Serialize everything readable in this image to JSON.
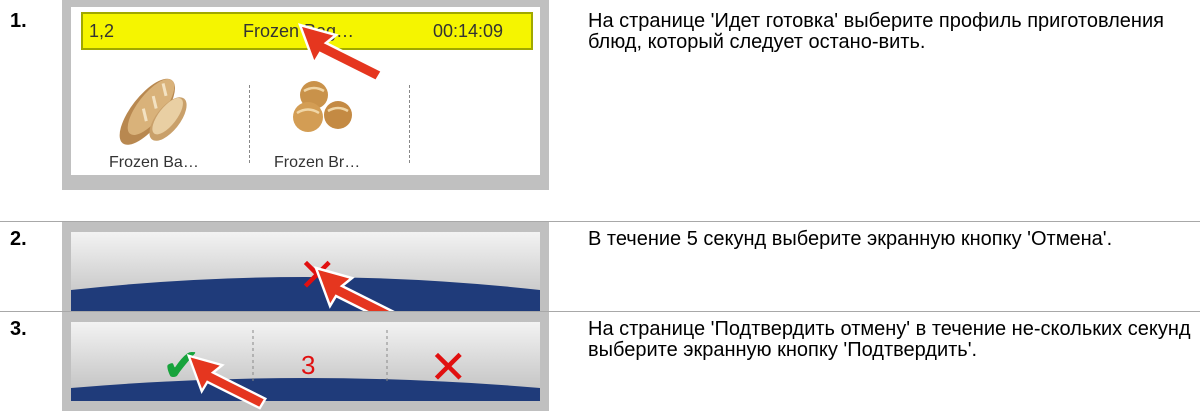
{
  "steps": [
    {
      "number": "1.",
      "text": "На странице 'Идет готовка' выберите профиль приготовления блюд, который следует остано-вить.",
      "screen": {
        "bar_col1": "1,2",
        "bar_col2": "Frozen Bag…",
        "bar_col3": "00:14:09",
        "tiles": [
          {
            "label": "Frozen Ba…",
            "icon": "baguette-icon"
          },
          {
            "label": "Frozen Br…",
            "icon": "bread-rolls-icon"
          }
        ]
      }
    },
    {
      "number": "2.",
      "text": "В течение 5 секунд выберите экранную кнопку 'Отмена'.",
      "screen": {
        "cancel_icon": "cancel-x-icon"
      }
    },
    {
      "number": "3.",
      "text": "На странице 'Подтвердить отмену' в течение не-скольких секунд выберите экранную кнопку 'Подтвердить'.",
      "screen": {
        "countdown": "3",
        "confirm_icon": "checkmark-icon",
        "cancel_icon": "cancel-x-icon"
      }
    }
  ],
  "colors": {
    "accent_yellow": "#f5f500",
    "cancel_red": "#e11010",
    "confirm_green": "#17a33c",
    "navy": "#1f3b7a",
    "arrow_red": "#e5361f"
  }
}
